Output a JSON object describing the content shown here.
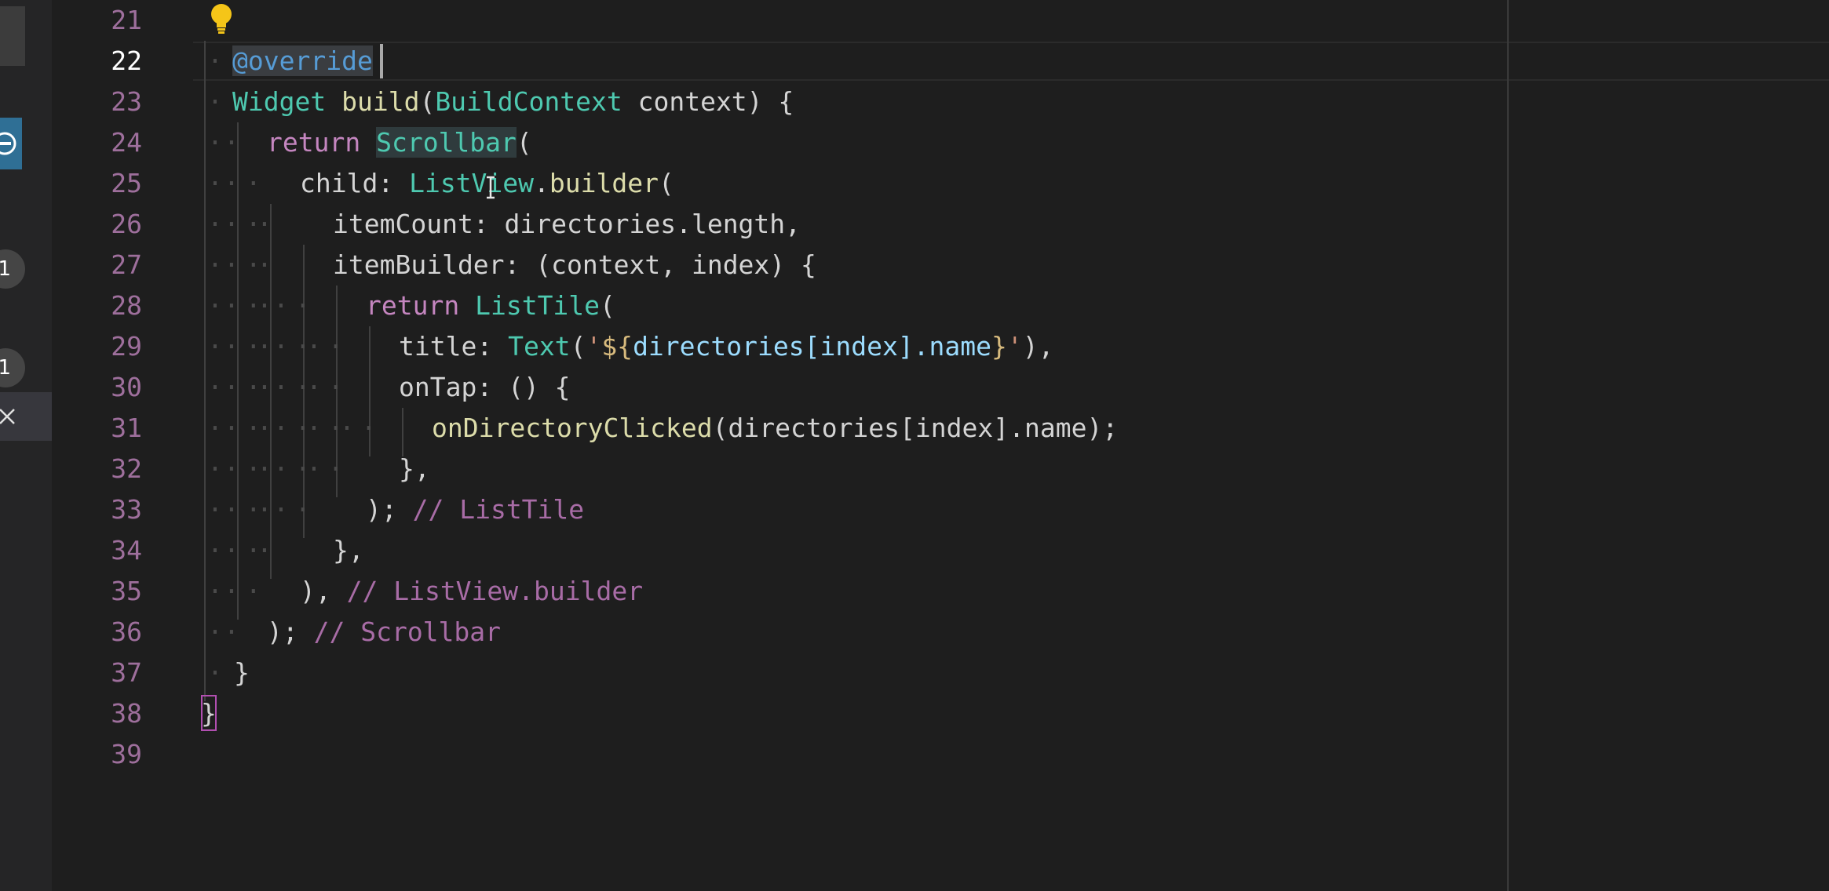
{
  "editor": {
    "active_line": 22,
    "line_numbers": [
      "21",
      "22",
      "23",
      "24",
      "25",
      "26",
      "27",
      "28",
      "29",
      "30",
      "31",
      "32",
      "33",
      "34",
      "35",
      "36",
      "37",
      "38",
      "39"
    ],
    "lines": [
      [],
      [
        {
          "t": "·",
          "c": "ws"
        },
        {
          "t": "@override",
          "c": "an"
        }
      ],
      [
        {
          "t": "·",
          "c": "ws"
        },
        {
          "t": "Widget",
          "c": "ty"
        },
        {
          "t": " ",
          "c": "pu"
        },
        {
          "t": "build",
          "c": "fn"
        },
        {
          "t": "(",
          "c": "pu"
        },
        {
          "t": "BuildContext",
          "c": "ty"
        },
        {
          "t": " context) {",
          "c": "id"
        }
      ],
      [
        {
          "t": "·",
          "c": "ws"
        },
        {
          "t": "·",
          "c": "ws"
        },
        {
          "t": "return",
          "c": "kw"
        },
        {
          "t": " ",
          "c": "pu"
        },
        {
          "t": "Scrollbar",
          "c": "ty"
        },
        {
          "t": "(",
          "c": "pu"
        }
      ],
      [
        {
          "t": "·",
          "c": "ws"
        },
        {
          "t": "··",
          "c": "ws"
        },
        {
          "t": "child: ",
          "c": "id"
        },
        {
          "t": "ListView",
          "c": "ty"
        },
        {
          "t": ".",
          "c": "pu"
        },
        {
          "t": "builder",
          "c": "fn"
        },
        {
          "t": "(",
          "c": "pu"
        }
      ],
      [
        {
          "t": "·",
          "c": "ws"
        },
        {
          "t": "··",
          "c": "ws"
        },
        {
          "t": "·",
          "c": "ws"
        },
        {
          "t": "itemCount: directories.length,",
          "c": "id"
        }
      ],
      [
        {
          "t": "·",
          "c": "ws"
        },
        {
          "t": "··",
          "c": "ws"
        },
        {
          "t": "·",
          "c": "ws"
        },
        {
          "t": "itemBuilder: (context, index) {",
          "c": "id"
        }
      ],
      [
        {
          "t": "·",
          "c": "ws"
        },
        {
          "t": "··",
          "c": "ws"
        },
        {
          "t": "·",
          "c": "ws"
        },
        {
          "t": "··",
          "c": "ws"
        },
        {
          "t": "return",
          "c": "kw"
        },
        {
          "t": " ",
          "c": "pu"
        },
        {
          "t": "ListTile",
          "c": "ty"
        },
        {
          "t": "(",
          "c": "pu"
        }
      ],
      [
        {
          "t": "·",
          "c": "ws"
        },
        {
          "t": "··",
          "c": "ws"
        },
        {
          "t": "·",
          "c": "ws"
        },
        {
          "t": "··",
          "c": "ws"
        },
        {
          "t": "··",
          "c": "ws"
        },
        {
          "t": "title: ",
          "c": "id"
        },
        {
          "t": "Text",
          "c": "ty"
        },
        {
          "t": "(",
          "c": "pu"
        },
        {
          "t": "'",
          "c": "st"
        },
        {
          "t": "${",
          "c": "ip"
        },
        {
          "t": "directories[index].name",
          "c": "va"
        },
        {
          "t": "}",
          "c": "ip"
        },
        {
          "t": "'",
          "c": "st"
        },
        {
          "t": "),",
          "c": "pu"
        }
      ],
      [
        {
          "t": "·",
          "c": "ws"
        },
        {
          "t": "··",
          "c": "ws"
        },
        {
          "t": "·",
          "c": "ws"
        },
        {
          "t": "··",
          "c": "ws"
        },
        {
          "t": "··",
          "c": "ws"
        },
        {
          "t": "onTap: () {",
          "c": "id"
        }
      ],
      [
        {
          "t": "·",
          "c": "ws"
        },
        {
          "t": "··",
          "c": "ws"
        },
        {
          "t": "·",
          "c": "ws"
        },
        {
          "t": "··",
          "c": "ws"
        },
        {
          "t": "··",
          "c": "ws"
        },
        {
          "t": "··",
          "c": "ws"
        },
        {
          "t": "onDirectoryClicked",
          "c": "fn"
        },
        {
          "t": "(directories[index].name);",
          "c": "id"
        }
      ],
      [
        {
          "t": "·",
          "c": "ws"
        },
        {
          "t": "··",
          "c": "ws"
        },
        {
          "t": "·",
          "c": "ws"
        },
        {
          "t": "··",
          "c": "ws"
        },
        {
          "t": "··",
          "c": "ws"
        },
        {
          "t": "},",
          "c": "pu"
        }
      ],
      [
        {
          "t": "·",
          "c": "ws"
        },
        {
          "t": "··",
          "c": "ws"
        },
        {
          "t": "·",
          "c": "ws"
        },
        {
          "t": "··",
          "c": "ws"
        },
        {
          "t": "); ",
          "c": "pu"
        },
        {
          "t": "// ListTile",
          "c": "cm"
        }
      ],
      [
        {
          "t": "·",
          "c": "ws"
        },
        {
          "t": "··",
          "c": "ws"
        },
        {
          "t": "·",
          "c": "ws"
        },
        {
          "t": "},",
          "c": "pu"
        }
      ],
      [
        {
          "t": "·",
          "c": "ws"
        },
        {
          "t": "··",
          "c": "ws"
        },
        {
          "t": "), ",
          "c": "pu"
        },
        {
          "t": "// ListView.builder",
          "c": "cm"
        }
      ],
      [
        {
          "t": "·",
          "c": "ws"
        },
        {
          "t": "·",
          "c": "ws"
        },
        {
          "t": "); ",
          "c": "pu"
        },
        {
          "t": "// Scrollbar",
          "c": "cm"
        }
      ],
      [
        {
          "t": "·",
          "c": "ws"
        },
        {
          "t": "}",
          "c": "pu"
        }
      ],
      [
        {
          "t": "}",
          "c": "br"
        }
      ],
      []
    ]
  },
  "activity_bar": {
    "badges": [
      "1",
      "1"
    ]
  },
  "colors": {
    "background": "#1e1e1e",
    "line_number": "#9e6f9c",
    "active_line_number": "#ffffff",
    "keyword": "#c586c0",
    "type": "#4ec9b0",
    "function": "#dcdcaa",
    "annotation": "#569cd6",
    "comment": "#a86ca6"
  }
}
